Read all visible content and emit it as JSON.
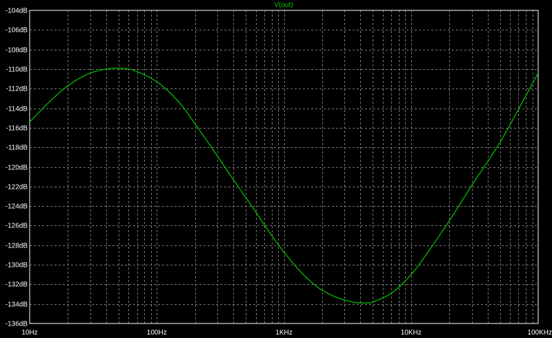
{
  "chart_data": {
    "type": "line",
    "title": "",
    "xlabel": "",
    "ylabel": "",
    "x_scale": "log",
    "xlim": [
      10,
      100000
    ],
    "ylim": [
      -136,
      -104
    ],
    "grid": true,
    "legend": "top-center",
    "x_tick_values": [
      10,
      100,
      1000,
      10000,
      100000
    ],
    "x_tick_labels": [
      "10Hz",
      "100Hz",
      "1KHz",
      "10KHz",
      "100KHz"
    ],
    "y_tick_values": [
      -104,
      -106,
      -108,
      -110,
      -112,
      -114,
      -116,
      -118,
      -120,
      -122,
      -124,
      -126,
      -128,
      -130,
      -132,
      -134,
      -136
    ],
    "y_tick_labels": [
      "-104dB",
      "-106dB",
      "-108dB",
      "-110dB",
      "-112dB",
      "-114dB",
      "-116dB",
      "-118dB",
      "-120dB",
      "-122dB",
      "-124dB",
      "-126dB",
      "-128dB",
      "-130dB",
      "-132dB",
      "-134dB",
      "-136dB"
    ],
    "series": [
      {
        "name": "V(out)",
        "color": "#00cc00",
        "x": [
          10,
          15,
          20,
          25,
          30,
          40,
          48,
          60,
          80,
          100,
          150,
          200,
          300,
          400,
          600,
          800,
          1000,
          1500,
          2000,
          3000,
          4000,
          4600,
          5500,
          7000,
          10000,
          15000,
          20000,
          30000,
          50000,
          70000,
          100000
        ],
        "y": [
          -115.4,
          -113.1,
          -111.7,
          -110.9,
          -110.4,
          -110.0,
          -109.9,
          -110.0,
          -110.6,
          -111.3,
          -113.4,
          -115.6,
          -118.9,
          -121.3,
          -124.6,
          -127.0,
          -128.7,
          -131.3,
          -132.6,
          -133.6,
          -133.9,
          -133.9,
          -133.6,
          -132.9,
          -131.0,
          -127.9,
          -125.5,
          -121.9,
          -117.5,
          -114.1,
          -110.4
        ]
      }
    ]
  },
  "colors": {
    "background": "#000000",
    "grid": "#7a7a7a",
    "axis": "#ffffff",
    "text": "#ffffff",
    "series": "#00cc00"
  }
}
